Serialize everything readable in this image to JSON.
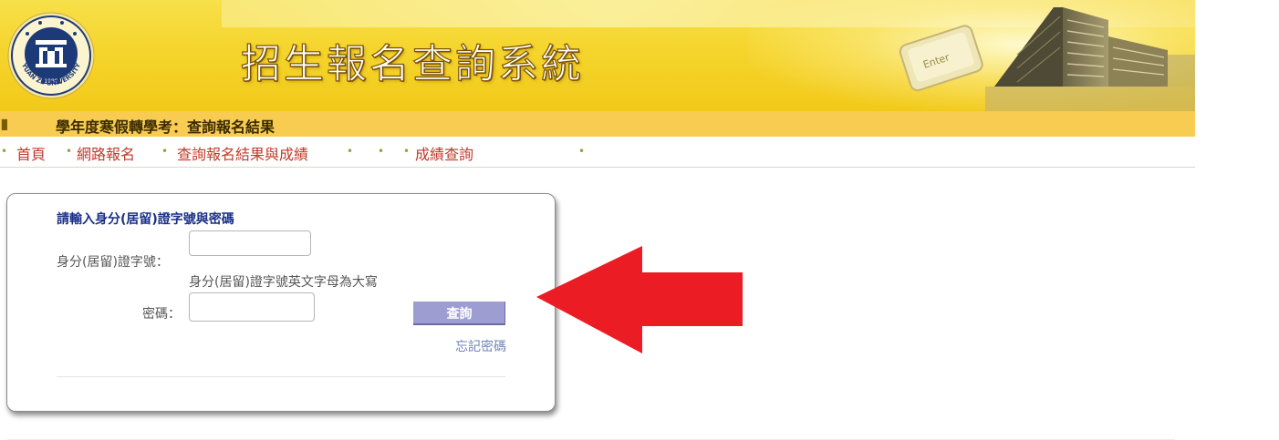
{
  "header": {
    "site_title": "招生報名查詢系統",
    "logo_year": "1989",
    "logo_text": "YUAN ZE UNIVERSITY",
    "keyboard_key": "Enter",
    "colors": {
      "banner": "#f5d52c",
      "subheader": "#f7cc50"
    }
  },
  "subheader": {
    "title": "學年度寒假轉學考：查詢報名結果"
  },
  "nav": {
    "items": [
      {
        "label": "首頁"
      },
      {
        "label": "網路報名"
      },
      {
        "label": "查詢報名結果與成績"
      },
      {
        "label": "成績查詢"
      }
    ],
    "bullet": "•"
  },
  "login": {
    "heading": "請輸入身分(居留)證字號與密碼",
    "id_label": "身分(居留)證字號：",
    "id_value": "",
    "id_hint": "身分(居留)證字號英文字母為大寫",
    "password_label": "密碼：",
    "password_value": "",
    "submit_label": "查詢",
    "forgot_label": "忘記密碼",
    "colors": {
      "heading": "#1a2f8a",
      "button": "#9e9dd2",
      "link": "#6f83b7"
    }
  },
  "annotation": {
    "arrow_color": "#ec1c24"
  }
}
